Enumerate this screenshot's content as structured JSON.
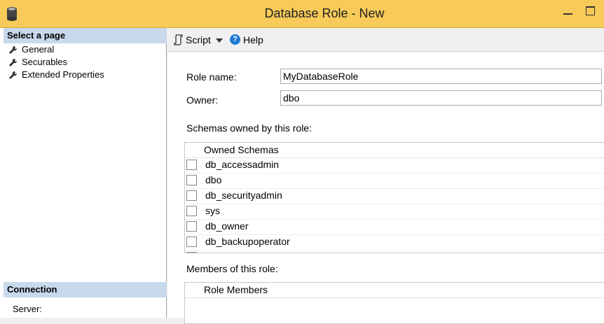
{
  "window": {
    "title": "Database Role - New"
  },
  "left_pane": {
    "select_header": "Select a page",
    "pages": [
      {
        "label": "General",
        "icon": "wrench-icon"
      },
      {
        "label": "Securables",
        "icon": "wrench-icon"
      },
      {
        "label": "Extended Properties",
        "icon": "wrench-icon"
      }
    ],
    "connection_header": "Connection",
    "server_label": "Server:"
  },
  "toolbar": {
    "script_label": "Script",
    "help_label": "Help",
    "help_glyph": "?"
  },
  "form": {
    "role_name_label": "Role name:",
    "role_name_value": "MyDatabaseRole",
    "owner_label": "Owner:",
    "owner_value": "dbo",
    "schemas_label": "Schemas owned by this role:",
    "schemas_column": "Owned Schemas",
    "schemas": [
      "db_accessadmin",
      "dbo",
      "db_securityadmin",
      "sys",
      "db_owner",
      "db_backupoperator"
    ],
    "members_label": "Members of this role:",
    "members_column": "Role Members"
  },
  "colors": {
    "titlebar": "#f7ca59",
    "pane_header": "#c9d9ec",
    "help_blue": "#1e7bd3"
  }
}
